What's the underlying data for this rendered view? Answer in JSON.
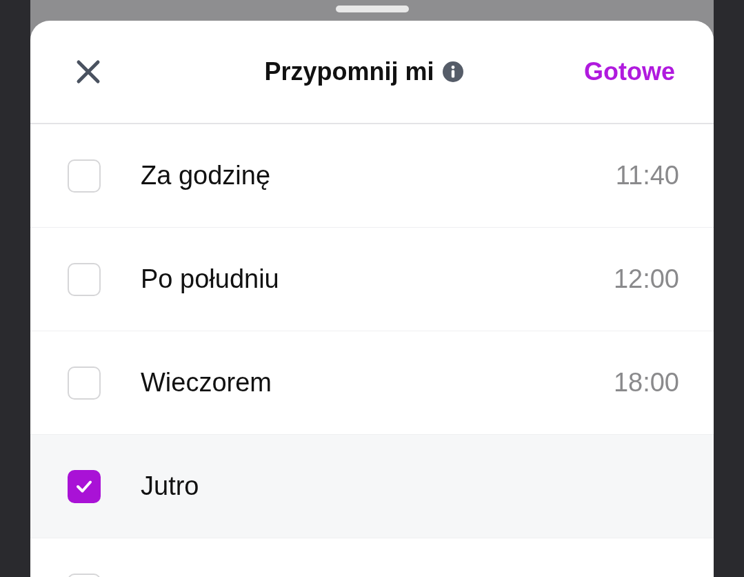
{
  "header": {
    "title": "Przypomnij mi",
    "done_label": "Gotowe"
  },
  "options": [
    {
      "label": "Za godzinę",
      "time": "11:40",
      "checked": false
    },
    {
      "label": "Po południu",
      "time": "12:00",
      "checked": false
    },
    {
      "label": "Wieczorem",
      "time": "18:00",
      "checked": false
    },
    {
      "label": "Jutro",
      "checked": true
    },
    {
      "checked": false
    }
  ]
}
